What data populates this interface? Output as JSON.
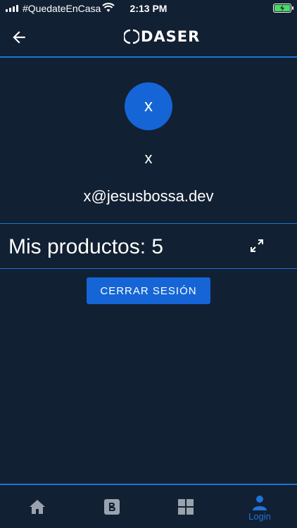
{
  "status_bar": {
    "carrier": "#QuedateEnCasa",
    "time": "2:13 PM"
  },
  "header": {
    "logo_text": "DASER"
  },
  "profile": {
    "avatar_initial": "x",
    "name": "x",
    "email": "x@jesusbossa.dev"
  },
  "products": {
    "label": "Mis productos: 5"
  },
  "logout_label": "CERRAR SESIÓN",
  "bottom_nav": {
    "login_label": "Login",
    "active_color": "#1e74d8",
    "inactive_color": "#9aa3ad"
  },
  "colors": {
    "background": "#122033",
    "accent": "#1e74d8",
    "button": "#1565d6"
  }
}
